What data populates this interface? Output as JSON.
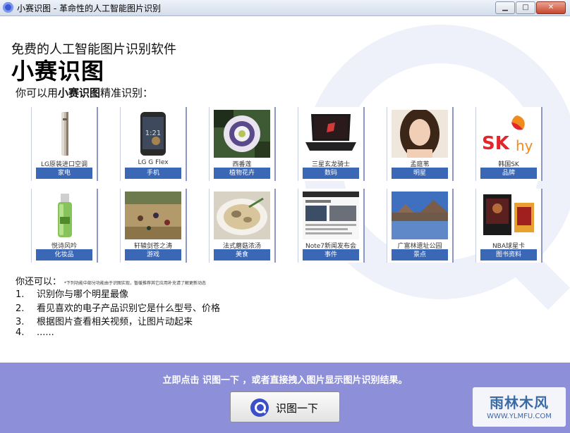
{
  "window": {
    "title": "小赛识图 - 革命性的人工智能图片识别",
    "minimize_label": "▁",
    "maximize_label": "□",
    "close_label": "✕"
  },
  "header": {
    "subtitle": "免费的人工智能图片识别软件",
    "title": "小赛识图",
    "intro_prefix": "你可以用",
    "intro_bold": "小赛识图",
    "intro_suffix": "精准识别："
  },
  "cards": [
    {
      "caption": "LG原装进口空调",
      "category": "家电"
    },
    {
      "caption": "LG G Flex",
      "category": "手机"
    },
    {
      "caption": "西番莲",
      "category": "植物花卉"
    },
    {
      "caption": "三星玄龙骑士",
      "category": "数码"
    },
    {
      "caption": "孟庭苇",
      "category": "明星"
    },
    {
      "caption": "韩国SK",
      "category": "品牌"
    },
    {
      "caption": "悦诗风吟",
      "category": "化妆品"
    },
    {
      "caption": "轩辕剑苍之涛",
      "category": "游戏"
    },
    {
      "caption": "法式蘑菇浓汤",
      "category": "美食"
    },
    {
      "caption": "Note7新闻发布会",
      "category": "事件"
    },
    {
      "caption": "广富林遗址公园",
      "category": "景点"
    },
    {
      "caption": "NBA球星卡",
      "category": "图书资料"
    }
  ],
  "more": {
    "heading": "你还可以：",
    "note": "*下列功能中部分功能由于识图实现，暂缓推荐其它应用补充请了解更新动态",
    "items": [
      {
        "num": "1.",
        "text": "识别你与哪个明星最像"
      },
      {
        "num": "2.",
        "text": "看见喜欢的电子产品识别它是什么型号、价格"
      },
      {
        "num": "3.",
        "text": "根据图片查看相关视频，让图片动起来"
      },
      {
        "num": "4.",
        "text": "......"
      }
    ]
  },
  "bottom": {
    "hint": "立即点击 识图一下 ，或者直接拽入图片显示图片识别结果。",
    "button_label": "识图一下"
  },
  "watermark": {
    "main": "雨林木风",
    "url": "WWW.YLMFU.COM"
  },
  "colors": {
    "category_bg": "#3a67b6",
    "bottom_bar": "#8d8fd8"
  }
}
